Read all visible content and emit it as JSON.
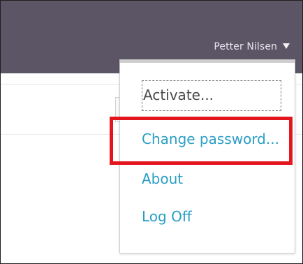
{
  "header": {
    "user_name": "Petter Nilsen",
    "dropdown_icon": "triangle-down-icon"
  },
  "menu": {
    "items": [
      {
        "label": "Activate...",
        "focused": true
      },
      {
        "label": "Change password...",
        "highlighted": true
      },
      {
        "label": "About"
      },
      {
        "label": "Log Off"
      }
    ]
  },
  "colors": {
    "topbar": "#5b5566",
    "link": "#2b9ec4",
    "highlight": "#e3161e"
  }
}
